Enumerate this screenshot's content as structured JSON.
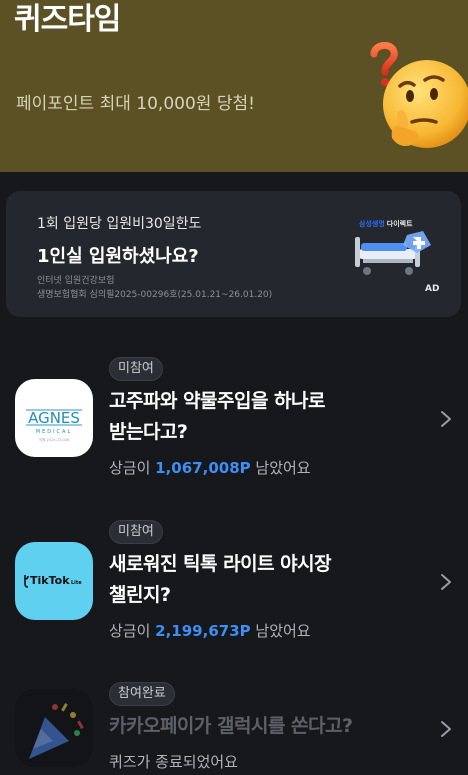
{
  "header": {
    "title": "퀴즈타임",
    "subtitle": "페이포인트 최대 10,000원 당첨!"
  },
  "ad": {
    "line1": "1회 입원당 입원비30일한도",
    "line2": "1인실 입원하셨나요?",
    "footnote1": "인터넷 입원건강보험",
    "footnote2": "생명보험협회 심의필2025-00296호(25.01.21~26.01.20)",
    "brand_name": "삼성생명",
    "brand_sub": "다이렉트",
    "tag": "AD"
  },
  "quizzes": [
    {
      "badge": "미참여",
      "title_line1": "고주파와 약물주입을 하나로",
      "title_line2": "받는다고?",
      "prize_prefix": "상금이 ",
      "prize_amount": "1,067,008P",
      "prize_suffix": " 남았어요",
      "logo_text": "AGNES",
      "logo_subtext": "MEDICAL",
      "logo_caption": "의원-2025-23-008"
    },
    {
      "badge": "미참여",
      "title_line1": "새로워진 틱톡 라이트 야시장",
      "title_line2": "챌린지?",
      "prize_prefix": "상금이 ",
      "prize_amount": "2,199,673P",
      "prize_suffix": " 남았어요",
      "logo_text": "TikTok",
      "logo_subtext": "Lite"
    },
    {
      "badge": "참여완료",
      "title_line1": "카카오페이가 갤럭시를 쏜다고?",
      "status": "퀴즈가 종료되었어요"
    }
  ],
  "colors": {
    "header_bg": "#5b5124",
    "page_bg": "#16181c",
    "card_bg": "#24272d",
    "accent_blue": "#3d8ef5"
  },
  "icons": [
    "thinking-face-icon",
    "hospital-bed-icon",
    "chevron-right-icon",
    "party-popper-icon"
  ]
}
